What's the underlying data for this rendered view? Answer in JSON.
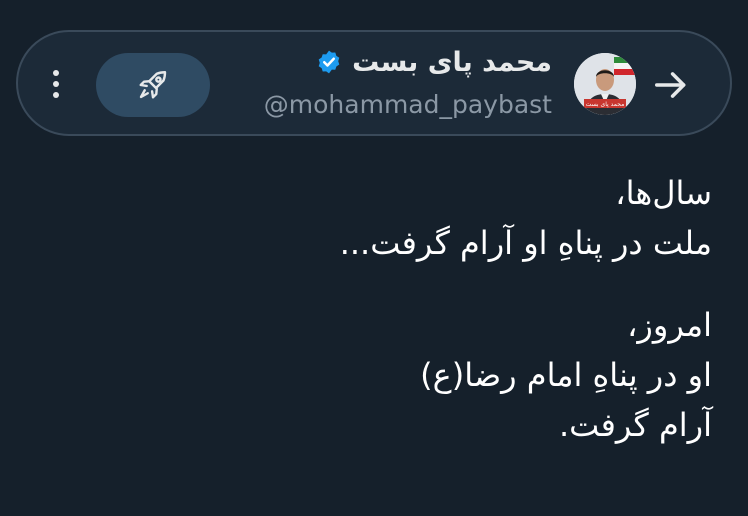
{
  "header": {
    "display_name": "محمد پای بست",
    "handle": "@mohammad_paybast",
    "verified": true,
    "icons": {
      "menu": "more-vertical-icon",
      "boost": "rocket-icon",
      "back": "arrow-right-icon",
      "verified": "verified-badge-icon"
    },
    "avatar_caption": "محمد پای بست"
  },
  "tweet": {
    "paragraphs": [
      [
        "سال‌ها،",
        "ملت در پناهِ او آرام گرفت..."
      ],
      [
        "امروز،",
        "او در پناهِ امام رضا(ع)",
        "آرام گرفت."
      ]
    ]
  },
  "colors": {
    "background": "#15202b",
    "header_pill": "#1c2a38",
    "header_border": "#3a4a5a",
    "boost_button": "#2f4b63",
    "verified": "#1d9bf0",
    "text_primary": "#e7e9ea",
    "text_secondary": "#8b98a5"
  }
}
